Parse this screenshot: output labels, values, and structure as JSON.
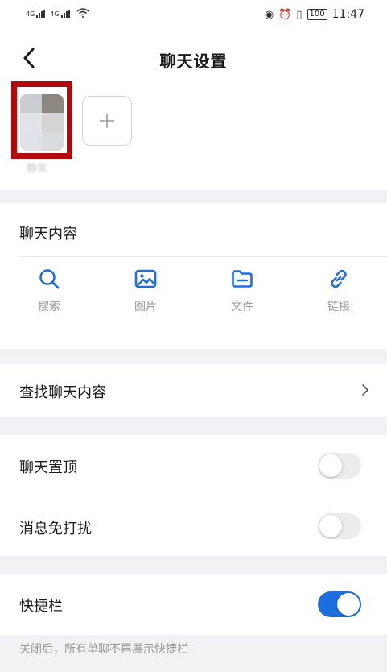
{
  "status_bar": {
    "signal_1_label": "4G",
    "signal_2_label": "4G",
    "battery": "100",
    "time": "11:47",
    "icons": [
      "eye-icon",
      "alarm-icon",
      "vibrate-icon",
      "battery-icon",
      "wifi-icon"
    ]
  },
  "nav": {
    "title": "聊天设置",
    "back_icon": "back-arrow-icon"
  },
  "members": {
    "name": "静笑",
    "add_icon": "plus-icon"
  },
  "chat_content": {
    "title": "聊天内容",
    "tools": [
      {
        "label": "搜索",
        "icon": "search-icon"
      },
      {
        "label": "图片",
        "icon": "image-icon"
      },
      {
        "label": "文件",
        "icon": "folder-icon"
      },
      {
        "label": "链接",
        "icon": "link-icon"
      }
    ]
  },
  "find": {
    "label": "查找聊天内容"
  },
  "settings": {
    "pin": {
      "label": "聊天置顶",
      "enabled": false
    },
    "mute": {
      "label": "消息免打扰",
      "enabled": false
    }
  },
  "shortcut": {
    "label": "快捷栏",
    "enabled": true,
    "hint": "关闭后，所有单聊不再展示快捷栏"
  },
  "colors": {
    "accent": "#1d6fe0",
    "highlight_border": "#b3080e",
    "background": "#f2f2f4"
  }
}
